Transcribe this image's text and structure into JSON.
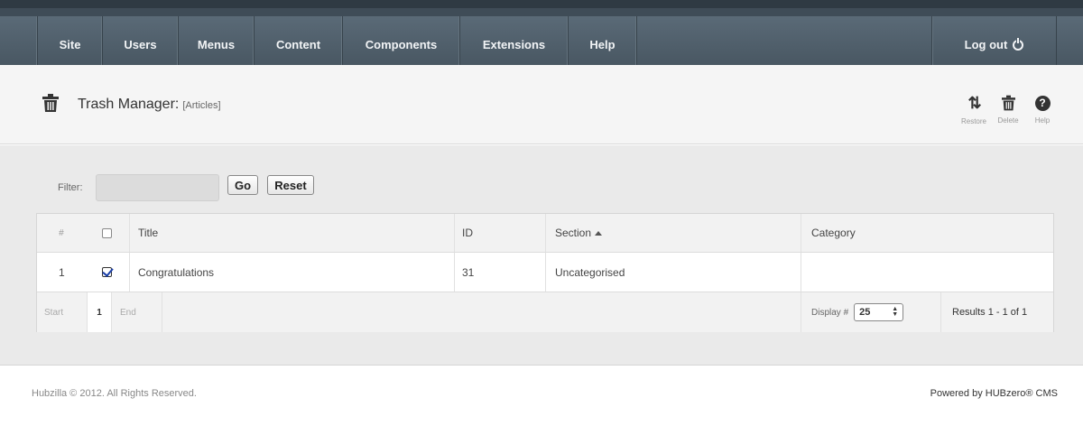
{
  "nav": {
    "items": [
      "Site",
      "Users",
      "Menus",
      "Content",
      "Components",
      "Extensions",
      "Help"
    ],
    "logout_label": "Log out"
  },
  "header": {
    "title": "Trash Manager:",
    "subtitle": "[Articles]",
    "toolbar": {
      "restore_label": "Restore",
      "delete_label": "Delete",
      "help_label": "Help"
    }
  },
  "filter": {
    "label": "Filter:",
    "value": "",
    "go_label": "Go",
    "reset_label": "Reset"
  },
  "table": {
    "columns": {
      "num": "#",
      "title": "Title",
      "id": "ID",
      "section": "Section",
      "category": "Category"
    },
    "rows": [
      {
        "num": "1",
        "checked": true,
        "title": "Congratulations",
        "id": "31",
        "section": "Uncategorised",
        "category": ""
      }
    ]
  },
  "pagination": {
    "start_label": "Start",
    "current_page": "1",
    "end_label": "End",
    "display_label": "Display #",
    "display_value": "25",
    "results_text": "Results 1 - 1 of 1"
  },
  "footer": {
    "copyright": "Hubzilla © 2012. All Rights Reserved.",
    "powered_by": "Powered by HUBzero® CMS"
  }
}
